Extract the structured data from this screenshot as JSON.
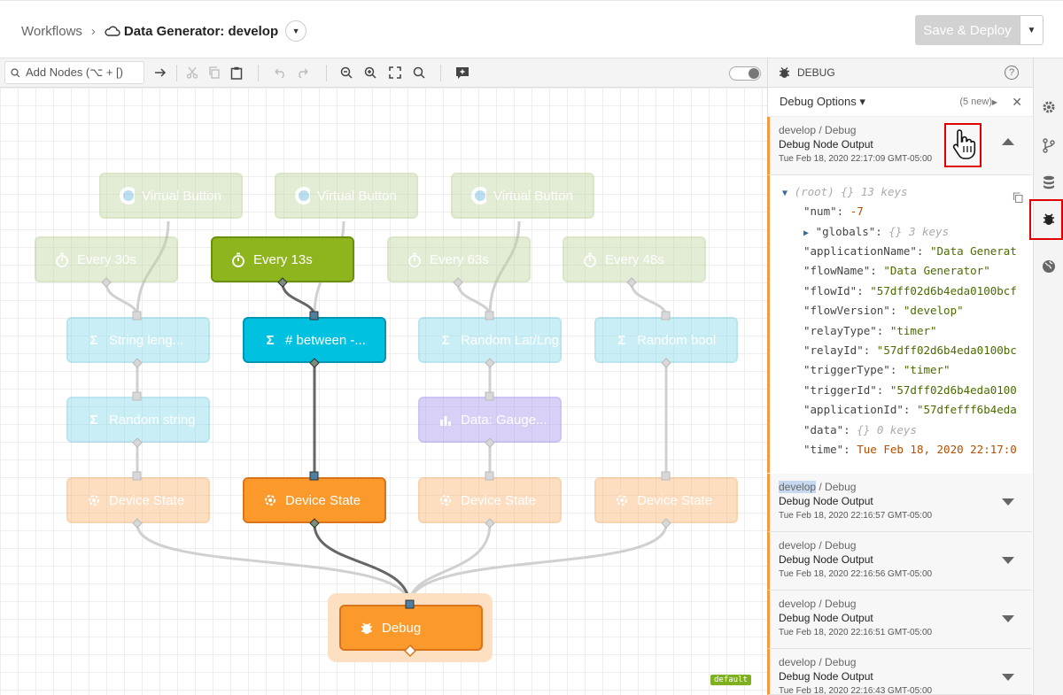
{
  "header": {
    "breadcrumb_root": "Workflows",
    "breadcrumb_sep": "›",
    "workflow_title": "Data Generator: develop",
    "deploy_label": "Save & Deploy"
  },
  "toolbar": {
    "search_placeholder": "Add Nodes (⌥ + [)"
  },
  "nodes": {
    "vb1": "Virtual Button",
    "vb2": "Virtual Button",
    "vb3": "Virtual Button",
    "t1": "Every 30s",
    "t2": "Every 13s",
    "t3": "Every 63s",
    "t4": "Every 48s",
    "f1": "String leng...",
    "f2": "# between -...",
    "f3": "Random Lat/Lng",
    "f4": "Random bool",
    "f5": "Random string",
    "g1": "Data: Gauge...",
    "d1": "Device State",
    "d2": "Device State",
    "d3": "Device State",
    "d4": "Device State",
    "debug": "Debug",
    "default_tag": "default"
  },
  "panel": {
    "title": "DEBUG",
    "options_label": "Debug Options ▾",
    "new_count": "(5 new)",
    "messages": [
      {
        "branch": "develop",
        "path_rest": " / Debug",
        "name": "Debug Node Output",
        "time": "Tue Feb 18, 2020 22:17:09 GMT-05:00"
      },
      {
        "branch": "develop",
        "path_rest": " / Debug",
        "name": "Debug Node Output",
        "time": "Tue Feb 18, 2020 22:16:57 GMT-05:00"
      },
      {
        "branch": "develop",
        "path_rest": " / Debug",
        "name": "Debug Node Output",
        "time": "Tue Feb 18, 2020 22:16:56 GMT-05:00"
      },
      {
        "branch": "develop",
        "path_rest": " / Debug",
        "name": "Debug Node Output",
        "time": "Tue Feb 18, 2020 22:16:51 GMT-05:00"
      },
      {
        "branch": "develop",
        "path_rest": " / Debug",
        "name": "Debug Node Output",
        "time": "Tue Feb 18, 2020 22:16:43 GMT-05:00"
      }
    ],
    "json": {
      "root": "(root)",
      "root_braces": "{}",
      "root_keys": "13 keys",
      "num_key": "\"num\":",
      "num_val": "-7",
      "globals_key": "\"globals\":",
      "globals_braces": "{}",
      "globals_keys": "3 keys",
      "appname_key": "\"applicationName\":",
      "appname_val": "\"Data Generat",
      "flowname_key": "\"flowName\":",
      "flowname_val": "\"Data Generator\"",
      "flowid_key": "\"flowId\":",
      "flowid_val": "\"57dff02d6b4eda0100bcf",
      "flowver_key": "\"flowVersion\":",
      "flowver_val": "\"develop\"",
      "relaytype_key": "\"relayType\":",
      "relaytype_val": "\"timer\"",
      "relayid_key": "\"relayId\":",
      "relayid_val": "\"57dff02d6b4eda0100bc",
      "triggertype_key": "\"triggerType\":",
      "triggertype_val": "\"timer\"",
      "triggerid_key": "\"triggerId\":",
      "triggerid_val": "\"57dff02d6b4eda0100",
      "appid_key": "\"applicationId\":",
      "appid_val": "\"57dfefff6b4eda",
      "data_key": "\"data\":",
      "data_braces": "{}",
      "data_keys": "0 keys",
      "time_key": "\"time\":",
      "time_val": "Tue Feb 18, 2020 22:17:0"
    }
  },
  "colors": {
    "accent_orange": "#fb9a2a",
    "timer_green": "#8eb51e",
    "function_cyan": "#00c1e0",
    "gauge_purple": "#a590f0",
    "highlight_red": "#e00000"
  },
  "icons": [
    "cloud-icon",
    "search-icon",
    "arrow-right-icon",
    "cut-icon",
    "copy-icon",
    "paste-icon",
    "undo-icon",
    "redo-icon",
    "zoom-out-icon",
    "zoom-in-icon",
    "fit-icon",
    "zoom-reset-icon",
    "comment-icon",
    "bug-icon",
    "help-icon",
    "pointer-hand-icon",
    "gear-icon",
    "branch-icon",
    "database-icon",
    "globe-icon"
  ]
}
